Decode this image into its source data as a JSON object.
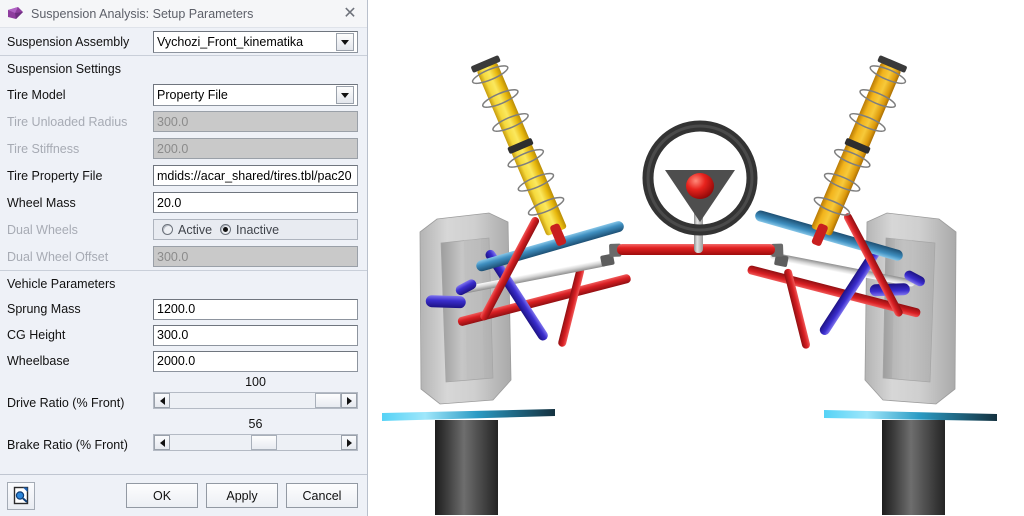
{
  "window": {
    "title": "Suspension Analysis: Setup Parameters",
    "app_icon": "adams-logo-icon",
    "close_label": "✕"
  },
  "form": {
    "assembly": {
      "label": "Suspension Assembly",
      "value": "Vychozi_Front_kinematika",
      "control": "dropdown"
    },
    "suspension_settings_header": "Suspension Settings",
    "vehicle_parameters_header": "Vehicle Parameters",
    "fields": [
      {
        "label": "Tire Model",
        "value": "Property File",
        "control": "dropdown",
        "enabled": true
      },
      {
        "label": "Tire Unloaded Radius",
        "value": "300.0",
        "control": "text",
        "enabled": false
      },
      {
        "label": "Tire Stiffness",
        "value": "200.0",
        "control": "text",
        "enabled": false
      },
      {
        "label": "Tire Property File",
        "value": "mdids://acar_shared/tires.tbl/pac20",
        "control": "text",
        "enabled": true
      },
      {
        "label": "Wheel Mass",
        "value": "20.0",
        "control": "text",
        "enabled": true
      }
    ],
    "dual_wheels": {
      "label": "Dual Wheels",
      "control": "radio",
      "options": [
        "Active",
        "Inactive"
      ],
      "selected": "Inactive"
    },
    "dual_wheel_offset": {
      "label": "Dual Wheel Offset",
      "value": "300.0",
      "control": "text",
      "enabled": false
    },
    "vehicle_fields": [
      {
        "label": "Sprung Mass",
        "value": "1200.0",
        "control": "text",
        "enabled": true
      },
      {
        "label": "CG Height",
        "value": "300.0",
        "control": "text",
        "enabled": true
      },
      {
        "label": "Wheelbase",
        "value": "2000.0",
        "control": "text",
        "enabled": true
      }
    ],
    "sliders": [
      {
        "label": "Drive Ratio (% Front)",
        "value": "100",
        "percent": 100,
        "min": 0,
        "max": 100
      },
      {
        "label": "Brake Ratio (% Front)",
        "value": "56",
        "percent": 56,
        "min": 0,
        "max": 100
      }
    ]
  },
  "footer": {
    "tool_icon": "page-inspect-icon",
    "ok_label": "OK",
    "apply_label": "Apply",
    "cancel_label": "Cancel"
  },
  "viewport": {
    "name": "suspension-3d-view",
    "background": "#ffffff",
    "colors": {
      "strut_left": "#f2cc26",
      "strut_right": "#f0a81d",
      "tire": "#c9c9c9",
      "upper_arm": "#3c88b8",
      "lower_arm": "#cf2026",
      "upright": "#3b2fd0",
      "tie_rod": "#d8d8d8",
      "rack": "#e02020",
      "steering_rim": "#3a3a3a",
      "steering_hub": "#e01818",
      "ground_plate": "#2bc4f0",
      "pedestal": "#3a3a3a"
    }
  }
}
